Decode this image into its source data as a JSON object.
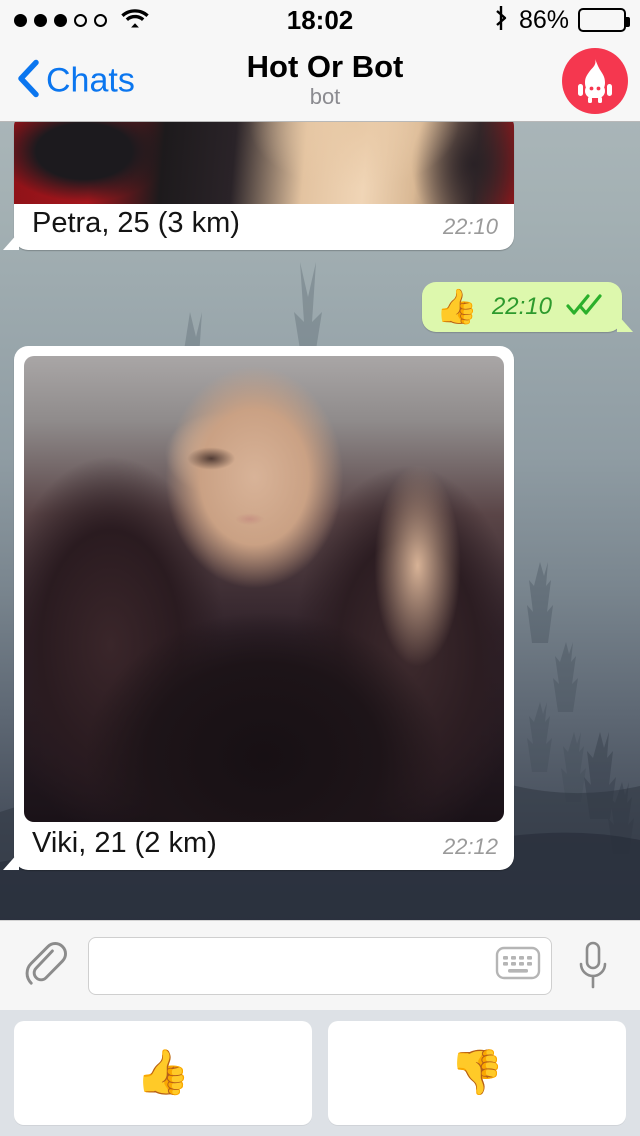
{
  "status_bar": {
    "signal_dots_filled": 3,
    "signal_dots_total": 5,
    "wifi_icon": "wifi-icon",
    "time": "18:02",
    "bluetooth_icon": "bluetooth-icon",
    "battery_percent_label": "86%",
    "battery_level": 86
  },
  "nav": {
    "back_label": "Chats",
    "back_icon": "chevron-left-icon",
    "title": "Hot Or Bot",
    "subtitle": "bot",
    "avatar_icon": "flame-bot-avatar-icon",
    "avatar_color": "#f5374f",
    "accent_color": "#0b76ef"
  },
  "chat": {
    "messages": [
      {
        "direction": "incoming",
        "type": "photo",
        "name": "Petra, 25 (3 km)",
        "time": "22:10",
        "photo_alt": "profile-photo-petra"
      },
      {
        "direction": "outgoing",
        "type": "emoji",
        "emoji": "👍",
        "emoji_name": "thumbs-up-emoji",
        "time": "22:10",
        "status_icon": "double-check-icon",
        "bubble_color": "#ddf8ad",
        "time_color": "#2d9a2d"
      },
      {
        "direction": "incoming",
        "type": "photo",
        "name": "Viki, 21 (2 km)",
        "time": "22:12",
        "photo_alt": "profile-photo-viki"
      }
    ]
  },
  "input_bar": {
    "attach_icon": "paperclip-icon",
    "message_value": "",
    "message_placeholder": "",
    "keyboard_icon": "keyboard-icon",
    "mic_icon": "microphone-icon"
  },
  "action_bar": {
    "buttons": [
      {
        "emoji": "👍",
        "name": "thumbs-up-button"
      },
      {
        "emoji": "👎",
        "name": "thumbs-down-button"
      }
    ]
  }
}
